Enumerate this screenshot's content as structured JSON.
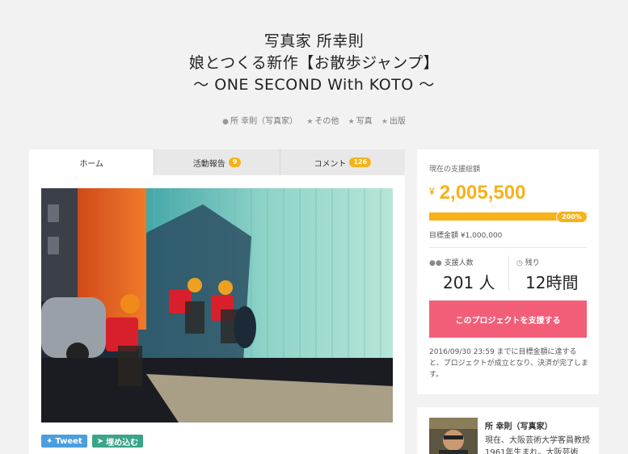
{
  "project": {
    "title_line1": "写真家 所幸則",
    "title_line2": "娘とつくる新作【お散歩ジャンプ】",
    "title_line3": "〜 ONE SECOND With KOTO 〜",
    "meta": [
      {
        "icon": "user-icon",
        "label": "所 幸則（写真家）"
      },
      {
        "icon": "star-icon",
        "label": "その他"
      },
      {
        "icon": "star-icon",
        "label": "写真"
      },
      {
        "icon": "star-icon",
        "label": "出版"
      }
    ]
  },
  "tabs": [
    {
      "label": "ホーム",
      "badge": ""
    },
    {
      "label": "活動報告",
      "badge": "9"
    },
    {
      "label": "コメント",
      "badge": "126"
    }
  ],
  "share": {
    "tweet_label": "Tweet",
    "embed_label": "埋め込む"
  },
  "funding": {
    "label": "現在の支援総額",
    "currency": "¥",
    "amount": "2,005,500",
    "progress_percent": 200,
    "progress_label": "200%",
    "goal_text": "目標金額 ¥1,000,000",
    "backers_label": "支援人数",
    "backers_value": "201 人",
    "remaining_label": "残り",
    "remaining_value": "12時間",
    "support_button": "このプロジェクトを支援する",
    "note": "2016/09/30 23:59 までに目標金額に達すると、プロジェクトが成立となり、決済が完了します。"
  },
  "profile": {
    "name": "所 幸則（写真家）",
    "description": "現在、大阪芸術大学客員教授 1961年生まれ。大阪芸術"
  },
  "colors": {
    "accent": "#f6b21b",
    "support_button": "#f25e78",
    "tweet": "#4a9ee0",
    "embed": "#3aa58a"
  }
}
